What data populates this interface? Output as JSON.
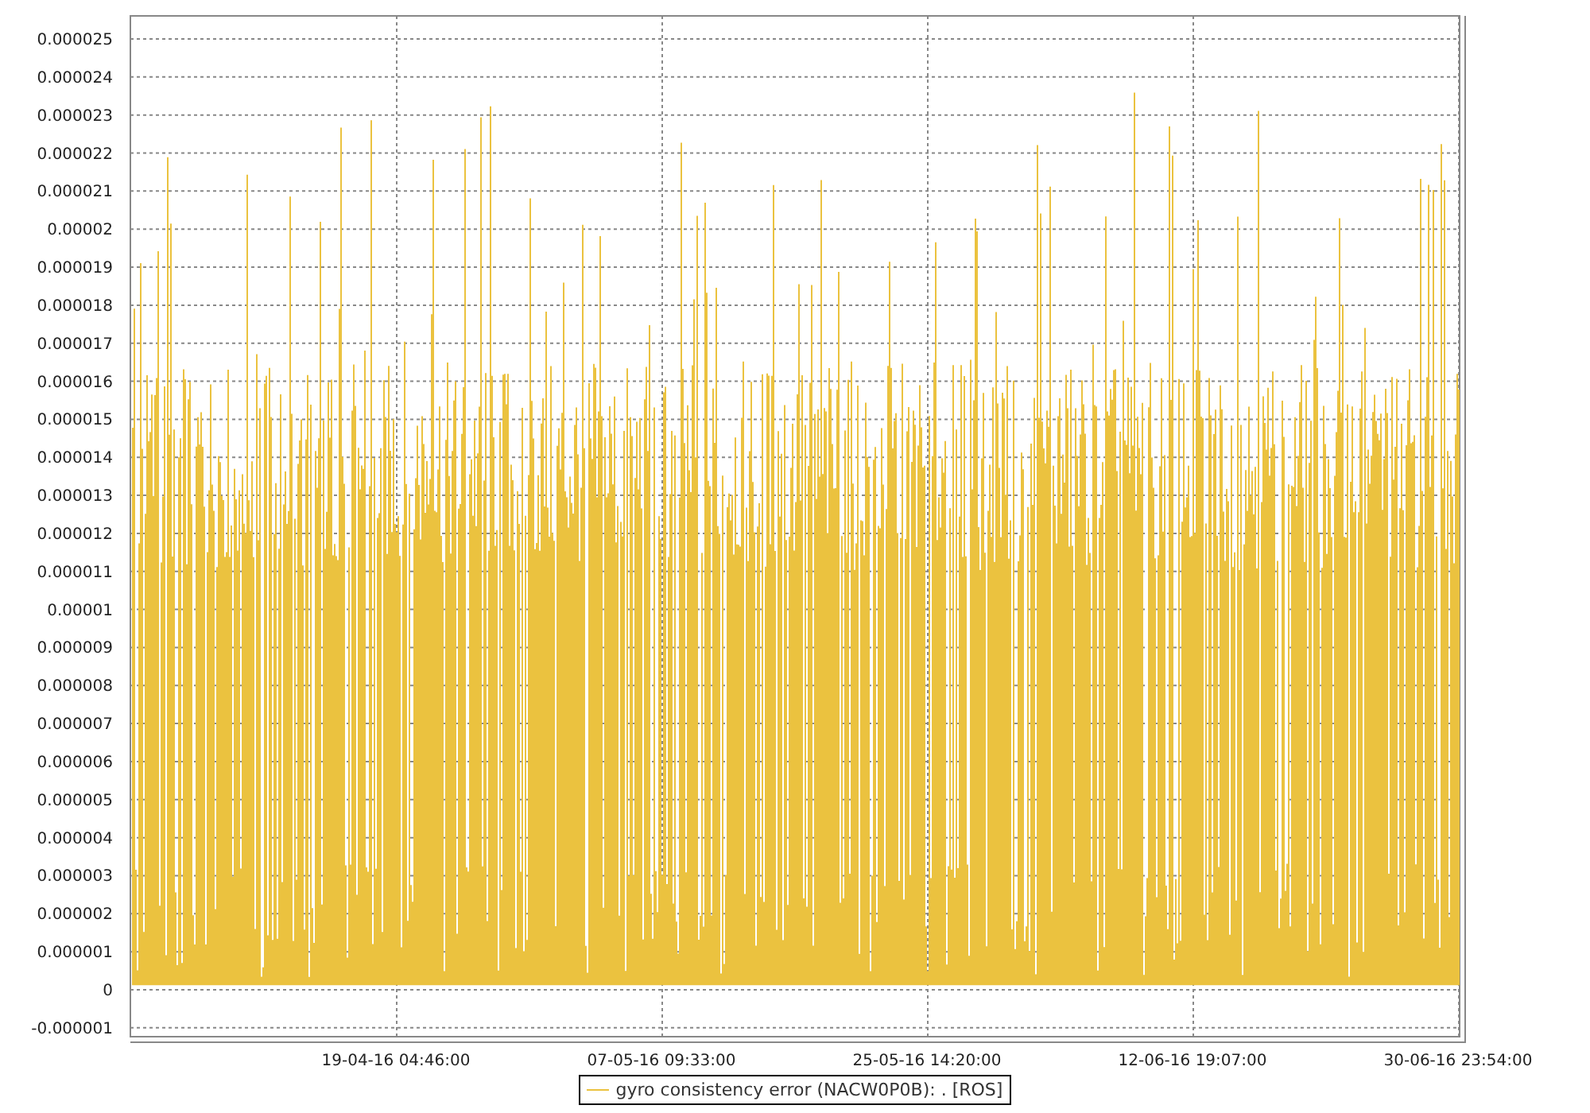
{
  "chart": {
    "y_tick_labels": [
      "0.000025",
      "0.000024",
      "0.000023",
      "0.000022",
      "0.000021",
      "0.00002",
      "0.000019",
      "0.000018",
      "0.000017",
      "0.000016",
      "0.000015",
      "0.000014",
      "0.000013",
      "0.000012",
      "0.000011",
      "0.00001",
      "0.000009",
      "0.000008",
      "0.000007",
      "0.000006",
      "0.000005",
      "0.000004",
      "0.000003",
      "0.000002",
      "0.000001",
      "0",
      "-0.000001"
    ],
    "x_tick_labels": [
      "19-04-16 04:46:00",
      "07-05-16 09:33:00",
      "25-05-16 14:20:00",
      "12-06-16 19:07:00",
      "30-06-16 23:54:00"
    ],
    "legend": {
      "label": "gyro consistency error (NACW0P0B): . [ROS]"
    }
  }
}
